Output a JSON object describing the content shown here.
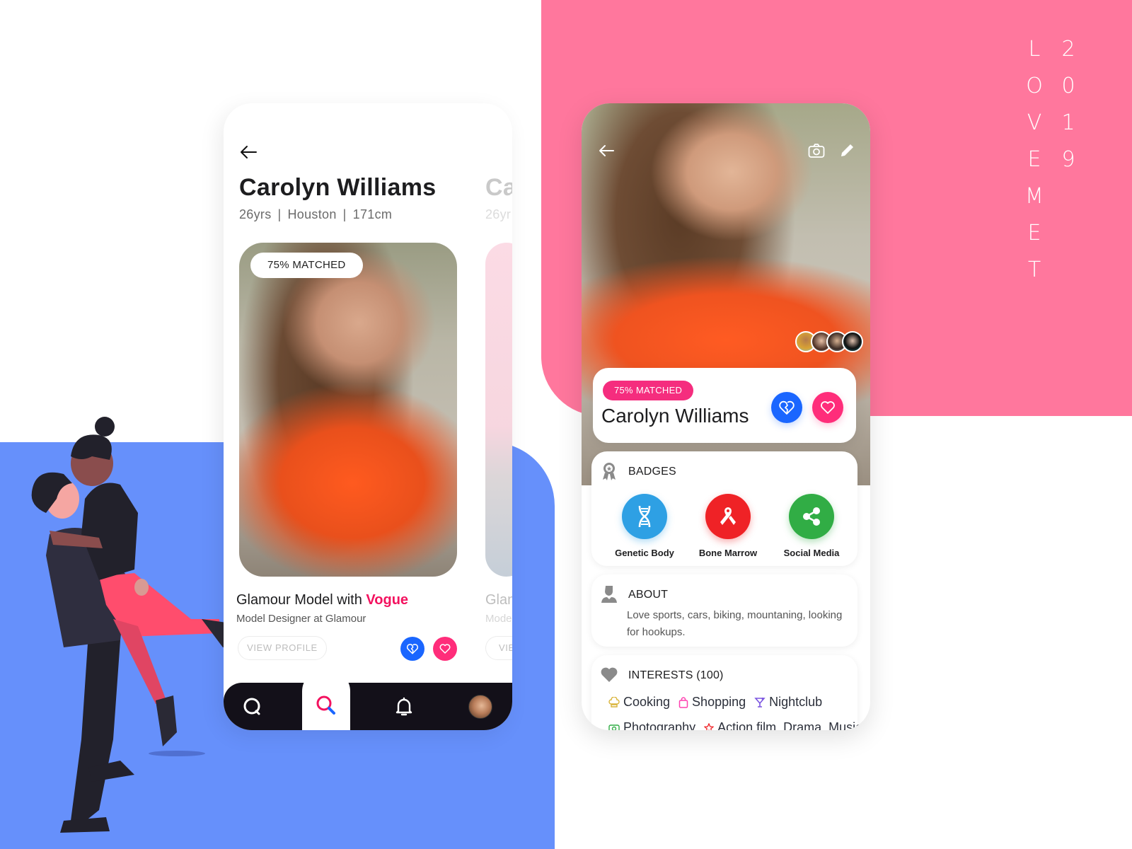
{
  "branding": {
    "title_letters": [
      "L",
      "O",
      "V",
      "E",
      "M",
      "E",
      "T"
    ],
    "year_digits": [
      "2",
      "0",
      "1",
      "9"
    ]
  },
  "colors": {
    "pink_bg": "#ff779d",
    "blue_bg": "#6690fb",
    "accent_pink": "#f52d7e",
    "brand_red": "#f3125f",
    "dislike_blue": "#1a66ff",
    "tabbar_dark": "#131019"
  },
  "discover_screen": {
    "back_icon": "arrow-left-icon",
    "profile": {
      "name": "Carolyn Williams",
      "age": "26yrs",
      "city": "Houston",
      "height": "171cm",
      "separator": "|",
      "match_label": "75% MATCHED",
      "job_prefix": "Glamour Model with ",
      "job_brand": "Vogue",
      "subtitle": "Model Designer at Glamour",
      "view_profile_label": "VIEW PROFILE"
    },
    "next_profile_peek": {
      "name": "Ca",
      "meta": "26yr",
      "job": "Glan",
      "subtitle": "Mode",
      "view_profile_label": "VIE"
    },
    "actions": {
      "dislike_icon": "broken-heart-icon",
      "like_icon": "heart-icon"
    },
    "tabbar": [
      {
        "name": "chat",
        "icon": "chat-bubble-icon",
        "active": false
      },
      {
        "name": "search",
        "icon": "search-icon",
        "active": true
      },
      {
        "name": "notifications",
        "icon": "bell-icon",
        "active": false
      },
      {
        "name": "profile",
        "icon": "avatar-icon",
        "active": false
      }
    ]
  },
  "profile_screen": {
    "header_icons": [
      "arrow-left-icon",
      "camera-icon",
      "pencil-icon"
    ],
    "match_label": "75% MATCHED",
    "name": "Carolyn Williams",
    "badges": {
      "title": "BADGES",
      "items": [
        {
          "label": "Genetic Body",
          "icon": "dna-icon",
          "color": "#2ea0e4"
        },
        {
          "label": "Bone Marrow",
          "icon": "ribbon-icon",
          "color": "#ef2226"
        },
        {
          "label": "Social Media",
          "icon": "share-icon",
          "color": "#31ad45"
        }
      ]
    },
    "about": {
      "title": "ABOUT",
      "text": "Love sports, cars, biking, mountaning, looking for hookups."
    },
    "interests": {
      "title": "INTERESTS (100)",
      "items": [
        {
          "label": "Cooking",
          "icon": "chef-hat-icon",
          "color": "#d9b43a"
        },
        {
          "label": "Shopping",
          "icon": "shopping-bag-icon",
          "color": "#ff40b0"
        },
        {
          "label": "Nightclub",
          "icon": "cocktail-icon",
          "color": "#7b55e0"
        }
      ],
      "items_partial": [
        {
          "label": "Photography",
          "icon": "camera-icon",
          "color": "#31ad45"
        },
        {
          "label": "Action film, Drama, Music",
          "icon": "star-icon",
          "color": "#ef2226"
        }
      ]
    }
  }
}
